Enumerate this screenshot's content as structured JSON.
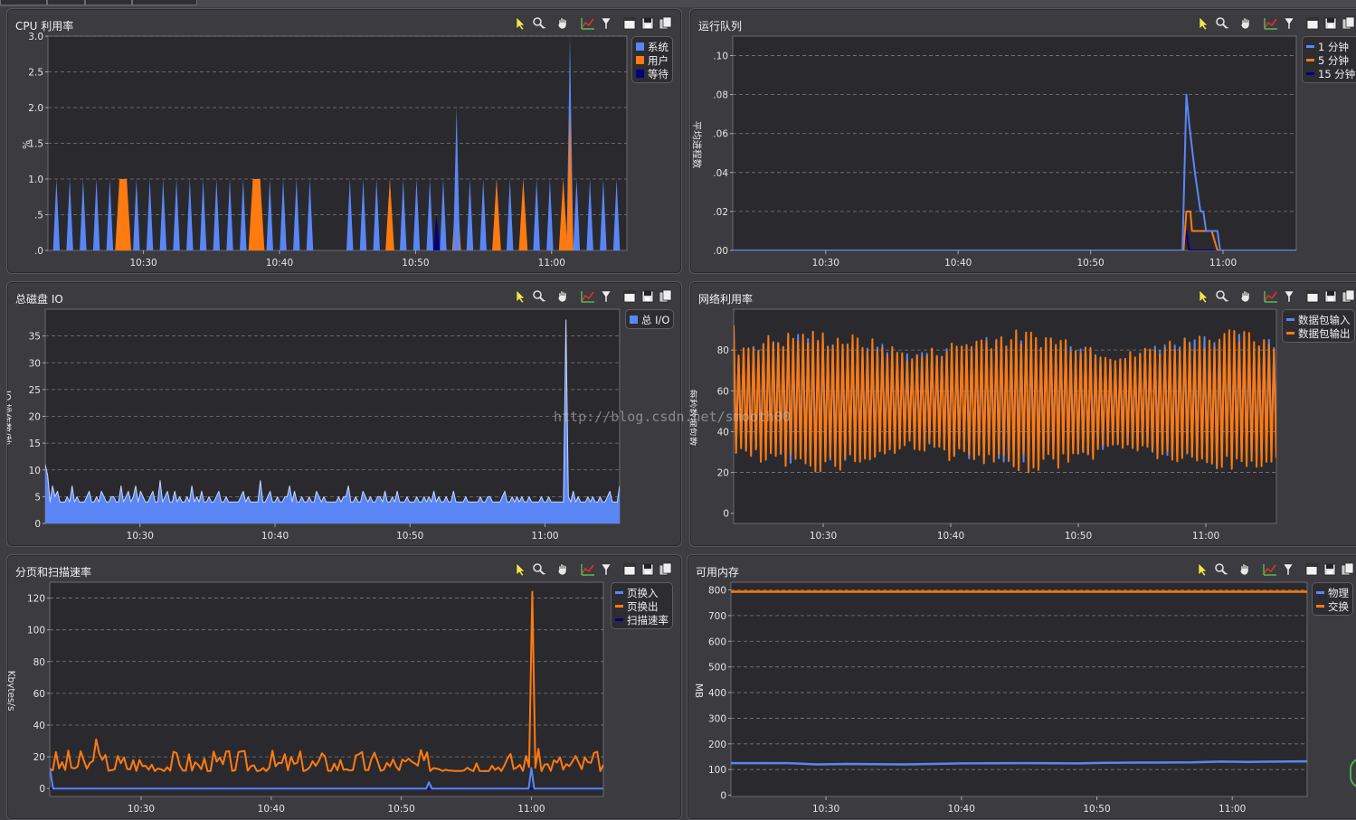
{
  "window": {
    "watermark": "http://blog.csdn.net/smooth00"
  },
  "colors": {
    "blue": "#5a86f5",
    "orange": "#ff7a10",
    "navy": "#000080",
    "plot_bg": "#2a2a2e",
    "grid": "#7a7a80",
    "axis_text": "#e6e6e6"
  },
  "toolbar_icons": [
    "select-pointer-icon",
    "zoom-icon",
    "pan-hand-icon",
    "chart-type-icon",
    "filter-icon",
    "window-icon",
    "save-icon",
    "copy-icon"
  ],
  "panels": [
    {
      "id": "cpu",
      "title": "CPU 利用率",
      "chart_data": {
        "type": "area",
        "title": "CPU 利用率",
        "xlabel": "",
        "ylabel": "%",
        "ylim": [
          0,
          3.0
        ],
        "yticks": [
          "3.0",
          "2.5",
          "2.0",
          "1.5",
          "1.0",
          ".5",
          ".0"
        ],
        "xticks": [
          "10:30",
          "10:40",
          "10:50",
          "11:00"
        ],
        "grid": true,
        "legend_position": "right",
        "series": [
          {
            "name": "系统",
            "color": "#5a86f5",
            "style": "area",
            "peaks": [
              [
                0,
                1
              ],
              [
                1,
                1
              ],
              [
                2,
                1
              ],
              [
                3,
                1
              ],
              [
                4,
                1
              ],
              [
                5,
                1
              ],
              [
                6,
                1
              ],
              [
                7,
                1
              ],
              [
                8,
                1
              ],
              [
                9,
                1
              ],
              [
                10,
                1
              ],
              [
                11,
                1
              ],
              [
                12,
                1
              ],
              [
                13,
                1
              ],
              [
                14,
                1
              ],
              [
                15,
                1
              ],
              [
                16,
                1
              ],
              [
                17,
                1
              ],
              [
                18,
                1
              ],
              [
                19,
                1
              ],
              [
                22,
                1
              ],
              [
                23,
                1
              ],
              [
                24,
                1
              ],
              [
                25,
                1
              ],
              [
                26,
                1
              ],
              [
                27,
                1
              ],
              [
                28,
                1
              ],
              [
                29,
                1
              ],
              [
                30,
                1
              ],
              [
                31,
                1
              ],
              [
                32,
                1
              ],
              [
                33,
                1
              ],
              [
                34,
                1
              ],
              [
                35,
                1
              ],
              [
                36,
                1
              ],
              [
                37,
                1
              ],
              [
                38,
                1
              ],
              [
                39,
                1
              ],
              [
                40,
                1
              ],
              [
                41,
                1
              ],
              [
                42,
                1
              ]
            ]
          },
          {
            "name": "用户",
            "color": "#ff7a10",
            "style": "area",
            "peaks": [
              [
                5,
                1
              ],
              [
                15,
                1
              ],
              [
                25,
                1
              ],
              [
                30,
                1
              ],
              [
                33,
                1
              ],
              [
                35,
                1
              ],
              [
                38,
                1
              ]
            ]
          },
          {
            "name": "等待",
            "color": "#000080",
            "style": "area",
            "peaks": [
              [
                28.5,
                0.5
              ]
            ]
          }
        ],
        "extra_spikes": [
          {
            "series": "系统",
            "pos": 30,
            "value": 2.0
          },
          {
            "series": "系统",
            "pos": 38.5,
            "value": 3.0
          },
          {
            "series": "用户",
            "pos": 38.5,
            "value": 2.0
          }
        ]
      },
      "legend": [
        {
          "label": "系统",
          "color": "#5a86f5"
        },
        {
          "label": "用户",
          "color": "#ff7a10"
        },
        {
          "label": "等待",
          "color": "#000080"
        }
      ]
    },
    {
      "id": "runqueue",
      "title": "运行队列",
      "chart_data": {
        "type": "line",
        "title": "运行队列",
        "xlabel": "",
        "ylabel": "平均进程数",
        "ylim": [
          0,
          0.11
        ],
        "yticks": [
          ".10",
          ".08",
          ".06",
          ".04",
          ".02",
          ".00"
        ],
        "xticks": [
          "10:30",
          "10:40",
          "10:50",
          "11:00"
        ],
        "grid": true,
        "legend_position": "right",
        "series": [
          {
            "name": "1 分钟",
            "color": "#5a86f5",
            "points": [
              [
                0,
                0
              ],
              [
                0.798,
                0
              ],
              [
                0.805,
                0.08
              ],
              [
                0.81,
                0.065
              ],
              [
                0.82,
                0.04
              ],
              [
                0.83,
                0.02
              ],
              [
                0.835,
                0.02
              ],
              [
                0.84,
                0.01
              ],
              [
                0.86,
                0.01
              ],
              [
                0.865,
                0
              ],
              [
                1,
                0
              ]
            ]
          },
          {
            "name": "5 分钟",
            "color": "#ff7a10",
            "points": [
              [
                0,
                0
              ],
              [
                0.8,
                0
              ],
              [
                0.805,
                0.02
              ],
              [
                0.812,
                0.02
              ],
              [
                0.815,
                0.01
              ],
              [
                0.83,
                0.01
              ],
              [
                0.85,
                0.01
              ],
              [
                0.86,
                0
              ],
              [
                1,
                0
              ]
            ]
          },
          {
            "name": "15 分钟",
            "color": "#000080",
            "points": [
              [
                0,
                0
              ],
              [
                0.8,
                0
              ],
              [
                0.805,
                0.01
              ],
              [
                0.81,
                0
              ],
              [
                1,
                0
              ]
            ]
          }
        ]
      },
      "legend": [
        {
          "label": "1 分钟",
          "color": "#5a86f5"
        },
        {
          "label": "5 分钟",
          "color": "#ff7a10"
        },
        {
          "label": "15 分钟",
          "color": "#000080"
        }
      ]
    },
    {
      "id": "diskio",
      "title": "总磁盘 IO",
      "chart_data": {
        "type": "area",
        "title": "总磁盘 IO",
        "xlabel": "",
        "ylabel": "IO 操作数/秒",
        "ylim": [
          0,
          40
        ],
        "yticks": [
          "35",
          "30",
          "25",
          "20",
          "15",
          "10",
          "5",
          "0"
        ],
        "xticks": [
          "10:30",
          "10:40",
          "10:50",
          "11:00"
        ],
        "grid": true,
        "legend_position": "right",
        "series": [
          {
            "name": "总 I/O",
            "color": "#5a86f5",
            "values": [
              11,
              9,
              4,
              7,
              5,
              6,
              4,
              4,
              4,
              5,
              4,
              7,
              4,
              5,
              4,
              4,
              4,
              5,
              6,
              4,
              4,
              5,
              4,
              6,
              5,
              4,
              4,
              5,
              5,
              4,
              4,
              7,
              4,
              5,
              6,
              4,
              5,
              7,
              4,
              6,
              5,
              4,
              4,
              5,
              6,
              4,
              4,
              8,
              4,
              5,
              6,
              4,
              4,
              6,
              4,
              5,
              4,
              4,
              5,
              4,
              7,
              4,
              5,
              4,
              6,
              4,
              4,
              5,
              4,
              4,
              5,
              6,
              4,
              4,
              5,
              4,
              4,
              4,
              4,
              4,
              5,
              6,
              4,
              5,
              4,
              4,
              4,
              4,
              8,
              4,
              4,
              5,
              6,
              4,
              4,
              5,
              4,
              4,
              5,
              5,
              7,
              4,
              6,
              4,
              4,
              5,
              4,
              4,
              5,
              4,
              4,
              6,
              5,
              4,
              5,
              4,
              4,
              4,
              4,
              4,
              5,
              4,
              5,
              5,
              7,
              4,
              4,
              5,
              4,
              4,
              6,
              5,
              4,
              5,
              4,
              4,
              5,
              5,
              4,
              6,
              4,
              4,
              5,
              4,
              6,
              4,
              4,
              4,
              5,
              4,
              4,
              4,
              5,
              4,
              4,
              5,
              4,
              5,
              4,
              6,
              4,
              5,
              4,
              4,
              5,
              4,
              4,
              6,
              4,
              4,
              4,
              4,
              5,
              4,
              4,
              4,
              4,
              4,
              5,
              4,
              4,
              5,
              5,
              4,
              4,
              4,
              4,
              5,
              6,
              4,
              4,
              5,
              4,
              5,
              4,
              5,
              4,
              4,
              5,
              4,
              4,
              4,
              4,
              5,
              4,
              4,
              5,
              4,
              4,
              4,
              4,
              4,
              4,
              38,
              5,
              4,
              6,
              4,
              5,
              4,
              4,
              4,
              5,
              4,
              5,
              4,
              4,
              5,
              4,
              4,
              5,
              6,
              4,
              4,
              4,
              7
            ]
          }
        ],
        "extra_spikes": [
          {
            "pos": 0.445,
            "value": 11
          },
          {
            "pos": 0.715,
            "value": 10
          }
        ]
      },
      "legend": [
        {
          "label": "总 I/O",
          "color": "#5a86f5"
        }
      ]
    },
    {
      "id": "network",
      "title": "网络利用率",
      "chart_data": {
        "type": "line",
        "title": "网络利用率",
        "xlabel": "",
        "ylabel": "每秒数据包数",
        "ylim": [
          -5,
          100
        ],
        "yticks": [
          "80",
          "60",
          "40",
          "20",
          "0"
        ],
        "xticks": [
          "10:30",
          "10:40",
          "10:50",
          "11:00"
        ],
        "grid": true,
        "legend_position": "right",
        "series": [
          {
            "name": "数据包输入",
            "color": "#5a86f5",
            "pattern": "oscillating",
            "mean": 56,
            "amplitude_range": [
              10,
              32
            ]
          },
          {
            "name": "数据包输出",
            "color": "#ff7a10",
            "pattern": "oscillating",
            "mean": 55,
            "amplitude_range": [
              10,
              35
            ]
          }
        ]
      },
      "legend": [
        {
          "label": "数据包输入",
          "color": "#5a86f5"
        },
        {
          "label": "数据包输出",
          "color": "#ff7a10"
        }
      ]
    },
    {
      "id": "paging",
      "title": "分页和扫描速率",
      "chart_data": {
        "type": "line",
        "title": "分页和扫描速率",
        "xlabel": "",
        "ylabel": "Kbytes/s",
        "ylim": [
          -5,
          130
        ],
        "yticks": [
          "120",
          "100",
          "80",
          "60",
          "40",
          "20",
          "0"
        ],
        "xticks": [
          "10:30",
          "10:40",
          "10:50",
          "11:00"
        ],
        "grid": true,
        "legend_position": "right",
        "series": [
          {
            "name": "页换入",
            "color": "#5a86f5",
            "points": [
              [
                0,
                13
              ],
              [
                0.006,
                0
              ],
              [
                0.68,
                0
              ],
              [
                0.685,
                4
              ],
              [
                0.69,
                0
              ],
              [
                0.865,
                0
              ],
              [
                0.87,
                13
              ],
              [
                0.875,
                0
              ],
              [
                1,
                0
              ]
            ]
          },
          {
            "name": "页换出",
            "color": "#ff7a10",
            "pattern": "noisy",
            "mean": 16,
            "range": [
              11,
              25
            ],
            "spikes": [
              [
                0.085,
                31
              ],
              [
                0.87,
                124
              ]
            ]
          },
          {
            "name": "扫描速率",
            "color": "#000080",
            "points": [
              [
                0,
                0
              ],
              [
                1,
                0
              ]
            ]
          }
        ]
      },
      "legend": [
        {
          "label": "页换入",
          "color": "#5a86f5"
        },
        {
          "label": "页换出",
          "color": "#ff7a10"
        },
        {
          "label": "扫描速率",
          "color": "#000080"
        }
      ]
    },
    {
      "id": "memory",
      "title": "可用内存",
      "chart_data": {
        "type": "line",
        "title": "可用内存",
        "xlabel": "",
        "ylabel": "MB",
        "ylim": [
          -5,
          830
        ],
        "yticks": [
          "800",
          "700",
          "600",
          "500",
          "400",
          "300",
          "200",
          "100",
          "0"
        ],
        "xticks": [
          "10:30",
          "10:40",
          "10:50",
          "11:00"
        ],
        "grid": true,
        "legend_position": "right",
        "series": [
          {
            "name": "物理",
            "color": "#5a86f5",
            "points": [
              [
                0,
                125
              ],
              [
                0.1,
                125
              ],
              [
                0.15,
                120
              ],
              [
                0.2,
                122
              ],
              [
                0.3,
                120
              ],
              [
                0.4,
                124
              ],
              [
                0.5,
                125
              ],
              [
                0.6,
                124
              ],
              [
                0.65,
                126
              ],
              [
                0.7,
                127
              ],
              [
                0.8,
                128
              ],
              [
                0.85,
                131
              ],
              [
                0.9,
                130
              ],
              [
                1,
                132
              ]
            ]
          },
          {
            "name": "交换",
            "color": "#ff7a10",
            "points": [
              [
                0,
                793
              ],
              [
                1,
                793
              ]
            ]
          }
        ]
      },
      "legend": [
        {
          "label": "物理",
          "color": "#5a86f5"
        },
        {
          "label": "交换",
          "color": "#ff7a10"
        }
      ]
    }
  ]
}
